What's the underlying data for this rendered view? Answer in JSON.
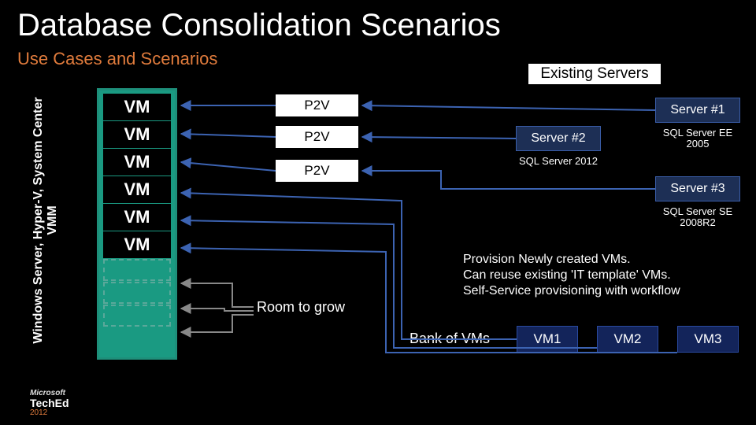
{
  "title": "Database Consolidation Scenarios",
  "subtitle": "Use Cases and Scenarios",
  "existing_label": "Existing Servers",
  "sidebar": {
    "line1": "Windows Server, Hyper-V, System Center",
    "line2": "VMM"
  },
  "vms": {
    "label": "VM"
  },
  "p2v": {
    "l1": "P2V",
    "l2": "P2V",
    "l3": "P2V"
  },
  "room": "Room to grow",
  "servers": {
    "s1": {
      "name": "Server #1",
      "desc": "SQL Server EE 2005"
    },
    "s2": {
      "name": "Server #2",
      "desc": "SQL Server 2012"
    },
    "s3": {
      "name": "Server #3",
      "desc": "SQL Server SE 2008R2"
    }
  },
  "provision": {
    "l1": "Provision Newly created VMs.",
    "l2": "Can reuse existing 'IT template' VMs.",
    "l3": "Self-Service provisioning with workflow"
  },
  "bank": {
    "label": "Bank of VMs",
    "v1": "VM1",
    "v2": "VM2",
    "v3": "VM3"
  },
  "footer": {
    "ms": "Microsoft",
    "brand": "TechEd",
    "year": "2012"
  }
}
